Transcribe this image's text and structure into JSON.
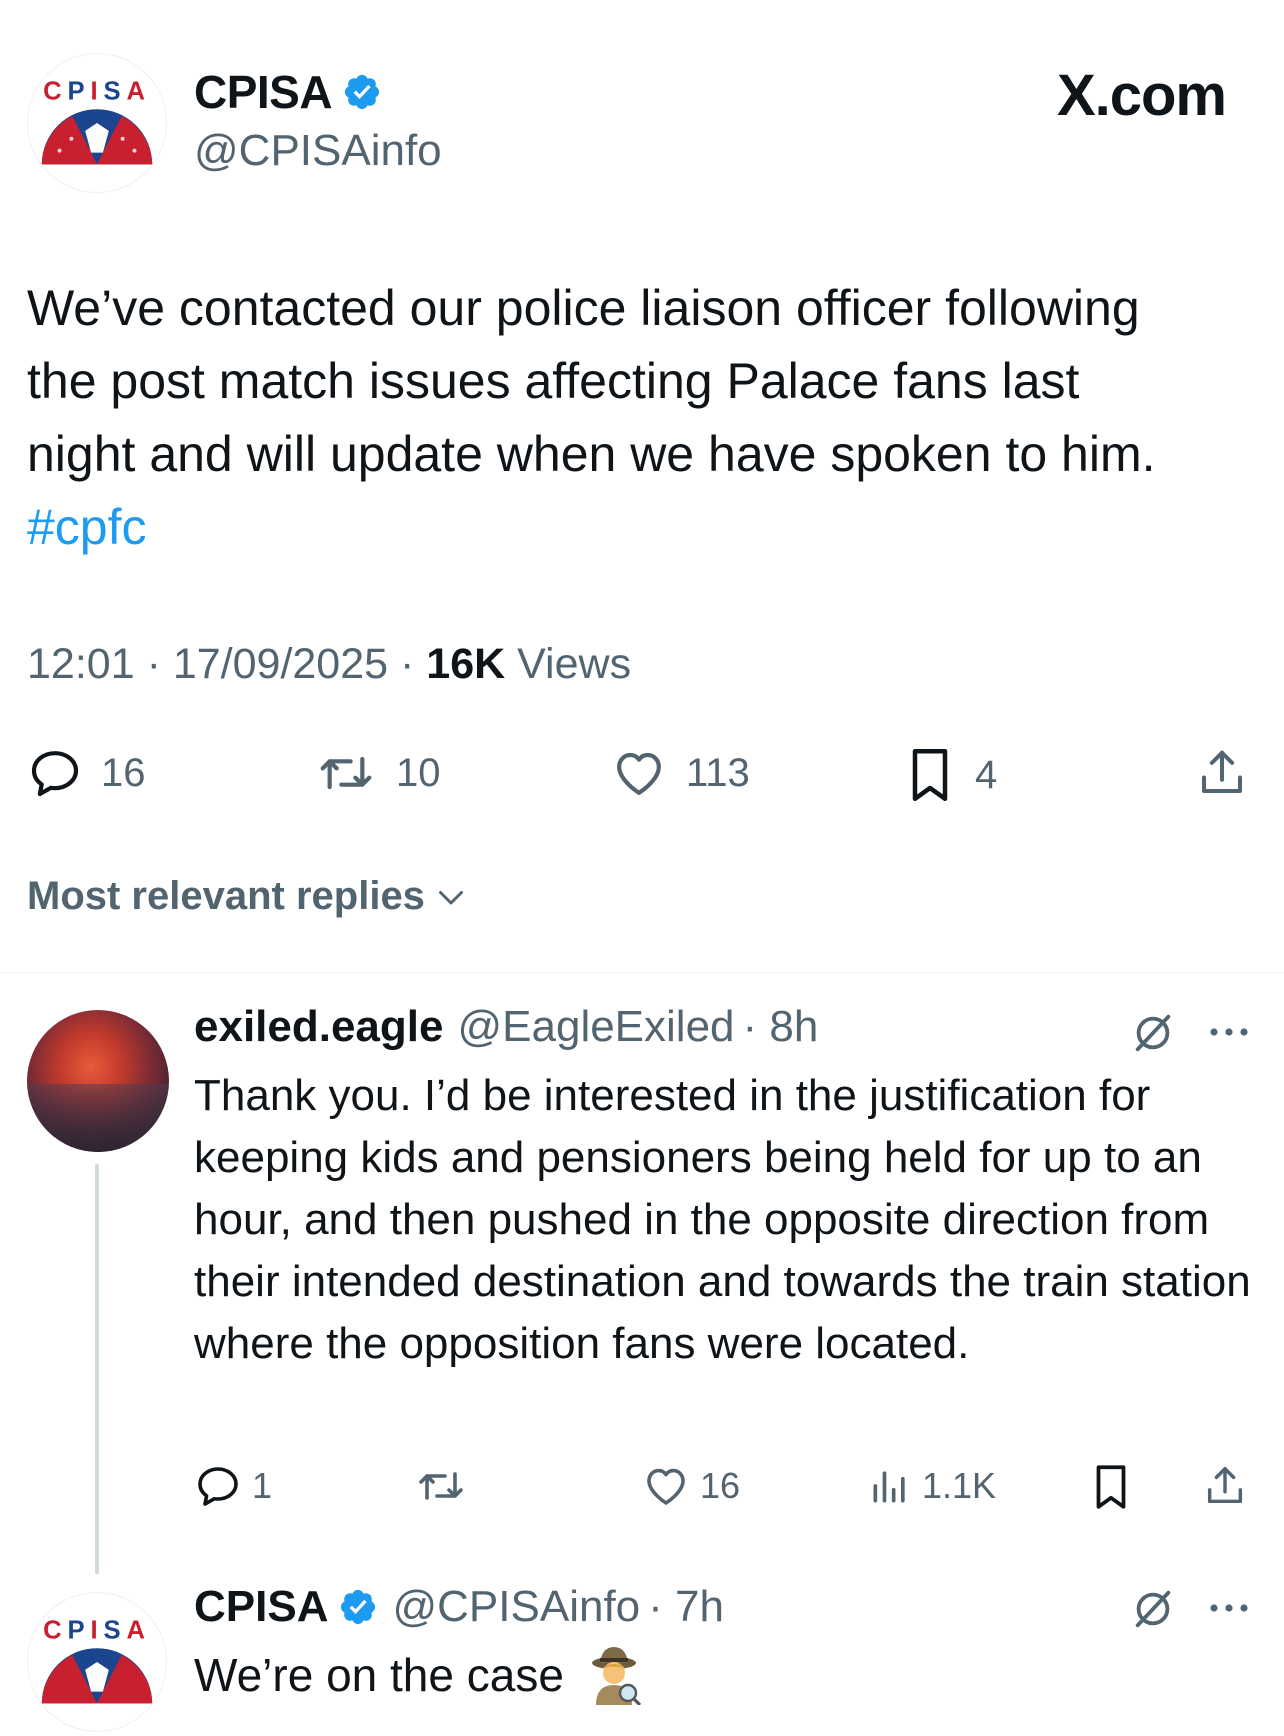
{
  "site_label": "X.com",
  "main_tweet": {
    "author_name": "CPISA",
    "author_handle": "@CPISAinfo",
    "logo_letters": "CPISA",
    "text_lines": [
      "We’ve contacted our police liaison officer following",
      "the post match issues affecting Palace fans last",
      "night and will update when we have spoken to him."
    ],
    "hashtag": "#cpfc",
    "time": "12:01",
    "date": "17/09/2025",
    "views_count": "16K",
    "views_label": "Views",
    "separator": "·",
    "stats": {
      "replies": "16",
      "reposts": "10",
      "likes": "113",
      "bookmarks": "4"
    }
  },
  "replies_sort_label": "Most relevant replies",
  "replies": [
    {
      "author_name": "exiled.eagle",
      "author_handle": "@EagleExiled",
      "time": "· 8h",
      "text": "Thank you. I’d be interested in the justification for keeping kids and pensioners being held for up to an hour, and then pushed in the opposite direction from their intended destination and towards the train station where the opposition fans were located.",
      "stats": {
        "replies": "1",
        "likes": "16",
        "views": "1.1K"
      }
    },
    {
      "author_name": "CPISA",
      "author_handle": "@CPISAinfo",
      "time": "· 7h",
      "text": "We’re on the case"
    }
  ],
  "colors": {
    "accent": "#1d9bf0",
    "secondary_text": "#536471",
    "primary_text": "#0f1419",
    "logo_red": "#c8202f",
    "logo_blue": "#1b458f"
  },
  "icons": [
    "verified-badge-icon",
    "reply-icon",
    "retweet-icon",
    "like-icon",
    "bookmark-icon",
    "share-icon",
    "views-icon",
    "grok-icon",
    "more-icon",
    "chevron-down-icon",
    "detective-emoji-icon"
  ]
}
